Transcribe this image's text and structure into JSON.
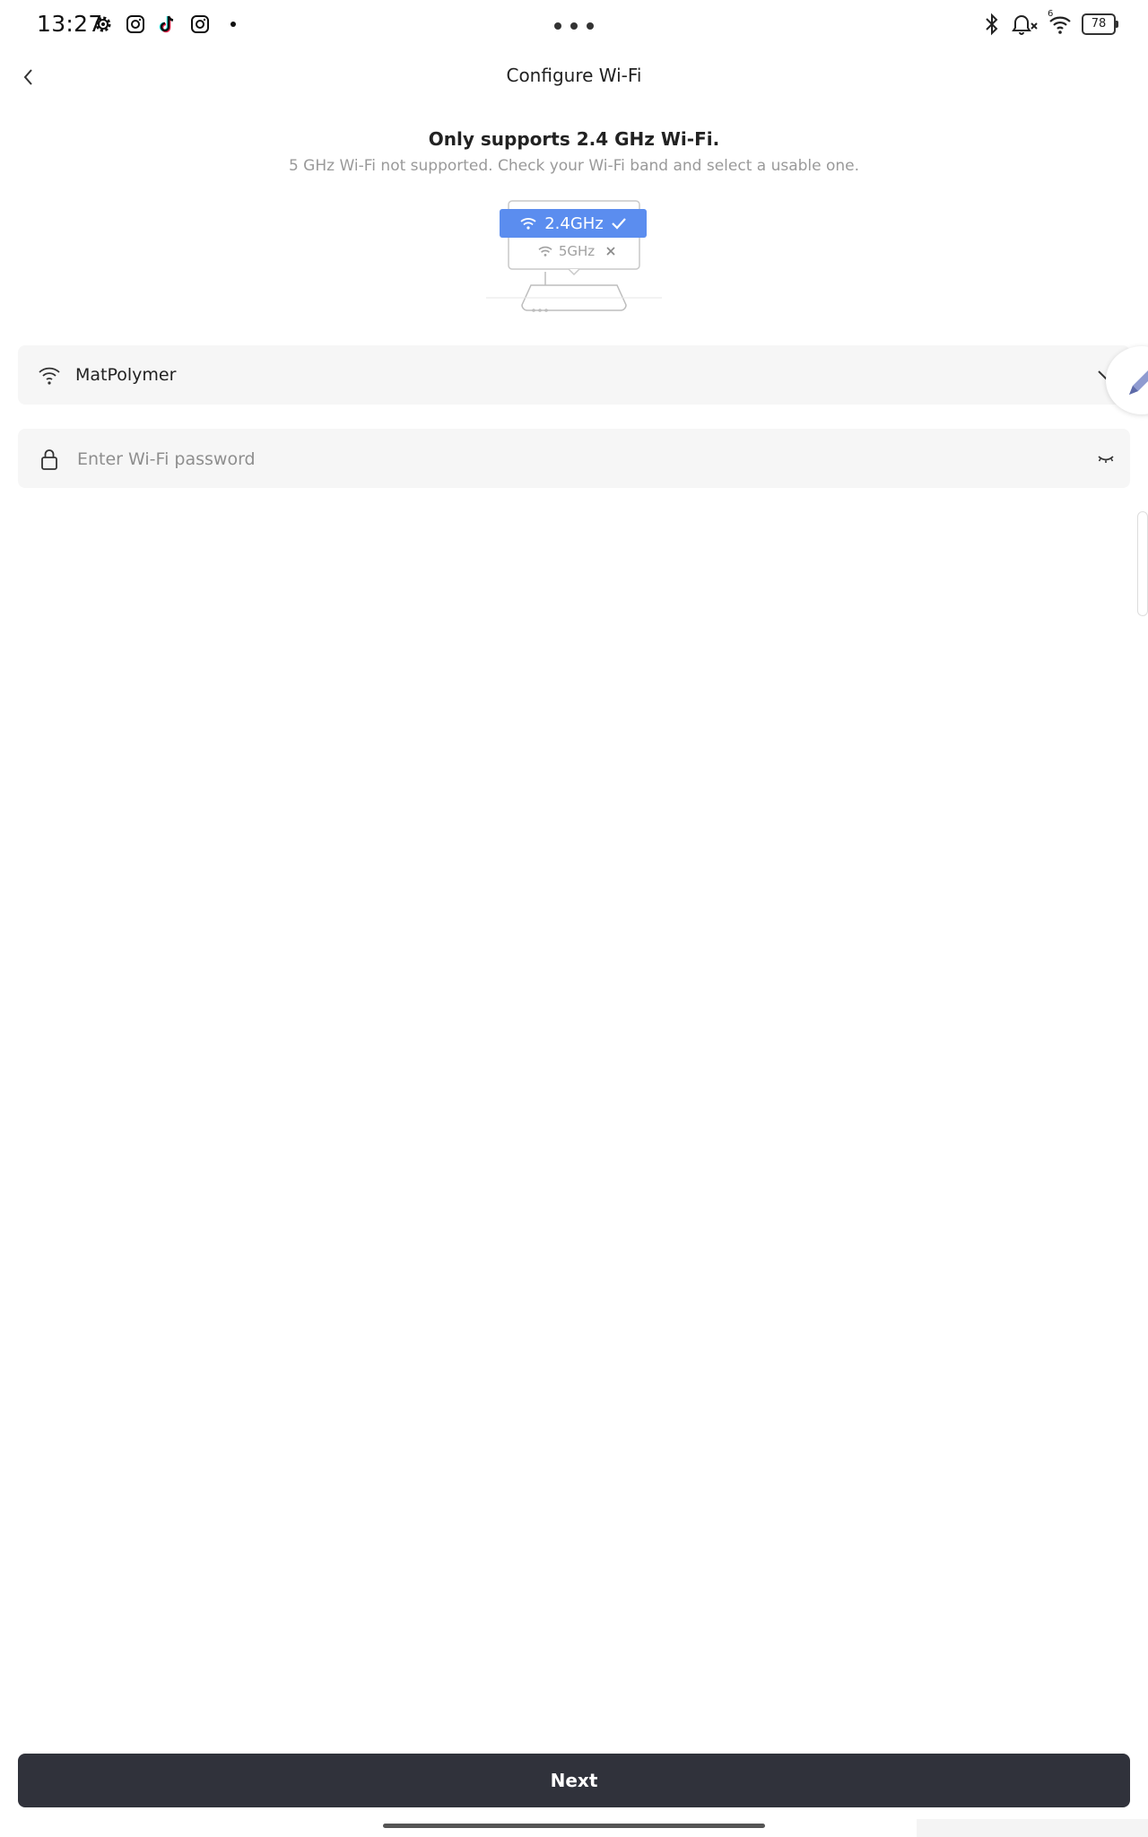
{
  "status_bar": {
    "time": "13:27",
    "left_icons": [
      "gear-icon",
      "instagram-icon",
      "tiktok-icon",
      "instagram-icon"
    ],
    "right_icons": [
      "bluetooth-icon",
      "bell-muted-icon",
      "wifi-icon"
    ],
    "wifi_badge": "6",
    "battery": "78"
  },
  "header": {
    "title": "Configure Wi-Fi"
  },
  "notice": {
    "title": "Only supports 2.4 GHz Wi-Fi.",
    "subtitle": "5 GHz Wi-Fi not supported. Check your Wi-Fi band and select a usable one."
  },
  "illustration": {
    "band_supported": "2.4GHz",
    "band_unsupported": "5GHz"
  },
  "wifi_select": {
    "selected_network": "MatPolymer"
  },
  "password": {
    "placeholder": "Enter Wi-Fi password",
    "value": ""
  },
  "footer": {
    "next_label": "Next"
  },
  "colors": {
    "accent": "#5b8def",
    "button": "#30323b",
    "field_bg": "#f6f6f6"
  }
}
